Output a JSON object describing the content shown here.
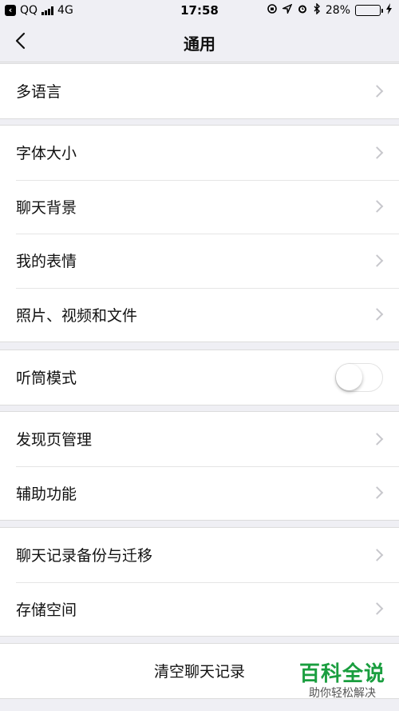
{
  "status_bar": {
    "back_app": "QQ",
    "carrier_network": "4G",
    "time": "17:58",
    "battery_percent": "28%",
    "battery_level": 0.28
  },
  "nav": {
    "title": "通用"
  },
  "groups": [
    [
      {
        "label": "多语言",
        "control": "chevron"
      }
    ],
    [
      {
        "label": "字体大小",
        "control": "chevron"
      },
      {
        "label": "聊天背景",
        "control": "chevron"
      },
      {
        "label": "我的表情",
        "control": "chevron"
      },
      {
        "label": "照片、视频和文件",
        "control": "chevron"
      }
    ],
    [
      {
        "label": "听筒模式",
        "control": "toggle",
        "on": false
      }
    ],
    [
      {
        "label": "发现页管理",
        "control": "chevron"
      },
      {
        "label": "辅助功能",
        "control": "chevron"
      }
    ],
    [
      {
        "label": "聊天记录备份与迁移",
        "control": "chevron"
      },
      {
        "label": "存储空间",
        "control": "chevron"
      }
    ],
    [
      {
        "label": "清空聊天记录",
        "control": "none"
      }
    ]
  ],
  "watermark": {
    "title": "百科全说",
    "subtitle": "助你轻松解决"
  },
  "colors": {
    "background": "#efeff4",
    "toggle_off": "#ffffff",
    "watermark_green": "#1a9e3f"
  }
}
